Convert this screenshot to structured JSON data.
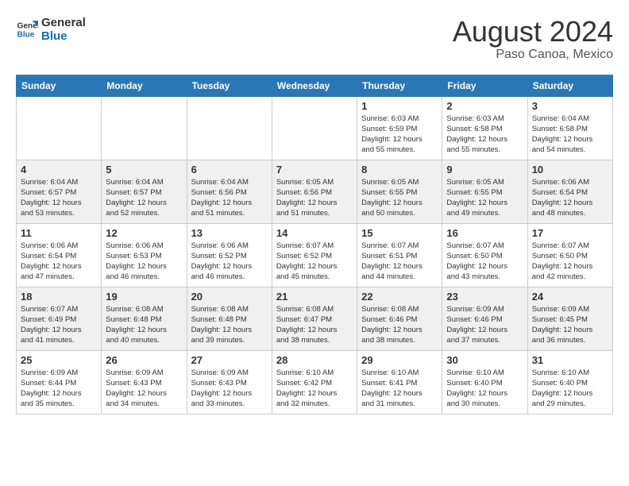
{
  "header": {
    "logo_line1": "General",
    "logo_line2": "Blue",
    "month_year": "August 2024",
    "location": "Paso Canoa, Mexico"
  },
  "weekdays": [
    "Sunday",
    "Monday",
    "Tuesday",
    "Wednesday",
    "Thursday",
    "Friday",
    "Saturday"
  ],
  "weeks": [
    [
      {
        "day": "",
        "info": ""
      },
      {
        "day": "",
        "info": ""
      },
      {
        "day": "",
        "info": ""
      },
      {
        "day": "",
        "info": ""
      },
      {
        "day": "1",
        "info": "Sunrise: 6:03 AM\nSunset: 6:59 PM\nDaylight: 12 hours\nand 55 minutes."
      },
      {
        "day": "2",
        "info": "Sunrise: 6:03 AM\nSunset: 6:58 PM\nDaylight: 12 hours\nand 55 minutes."
      },
      {
        "day": "3",
        "info": "Sunrise: 6:04 AM\nSunset: 6:58 PM\nDaylight: 12 hours\nand 54 minutes."
      }
    ],
    [
      {
        "day": "4",
        "info": "Sunrise: 6:04 AM\nSunset: 6:57 PM\nDaylight: 12 hours\nand 53 minutes."
      },
      {
        "day": "5",
        "info": "Sunrise: 6:04 AM\nSunset: 6:57 PM\nDaylight: 12 hours\nand 52 minutes."
      },
      {
        "day": "6",
        "info": "Sunrise: 6:04 AM\nSunset: 6:56 PM\nDaylight: 12 hours\nand 51 minutes."
      },
      {
        "day": "7",
        "info": "Sunrise: 6:05 AM\nSunset: 6:56 PM\nDaylight: 12 hours\nand 51 minutes."
      },
      {
        "day": "8",
        "info": "Sunrise: 6:05 AM\nSunset: 6:55 PM\nDaylight: 12 hours\nand 50 minutes."
      },
      {
        "day": "9",
        "info": "Sunrise: 6:05 AM\nSunset: 6:55 PM\nDaylight: 12 hours\nand 49 minutes."
      },
      {
        "day": "10",
        "info": "Sunrise: 6:06 AM\nSunset: 6:54 PM\nDaylight: 12 hours\nand 48 minutes."
      }
    ],
    [
      {
        "day": "11",
        "info": "Sunrise: 6:06 AM\nSunset: 6:54 PM\nDaylight: 12 hours\nand 47 minutes."
      },
      {
        "day": "12",
        "info": "Sunrise: 6:06 AM\nSunset: 6:53 PM\nDaylight: 12 hours\nand 46 minutes."
      },
      {
        "day": "13",
        "info": "Sunrise: 6:06 AM\nSunset: 6:52 PM\nDaylight: 12 hours\nand 46 minutes."
      },
      {
        "day": "14",
        "info": "Sunrise: 6:07 AM\nSunset: 6:52 PM\nDaylight: 12 hours\nand 45 minutes."
      },
      {
        "day": "15",
        "info": "Sunrise: 6:07 AM\nSunset: 6:51 PM\nDaylight: 12 hours\nand 44 minutes."
      },
      {
        "day": "16",
        "info": "Sunrise: 6:07 AM\nSunset: 6:50 PM\nDaylight: 12 hours\nand 43 minutes."
      },
      {
        "day": "17",
        "info": "Sunrise: 6:07 AM\nSunset: 6:50 PM\nDaylight: 12 hours\nand 42 minutes."
      }
    ],
    [
      {
        "day": "18",
        "info": "Sunrise: 6:07 AM\nSunset: 6:49 PM\nDaylight: 12 hours\nand 41 minutes."
      },
      {
        "day": "19",
        "info": "Sunrise: 6:08 AM\nSunset: 6:48 PM\nDaylight: 12 hours\nand 40 minutes."
      },
      {
        "day": "20",
        "info": "Sunrise: 6:08 AM\nSunset: 6:48 PM\nDaylight: 12 hours\nand 39 minutes."
      },
      {
        "day": "21",
        "info": "Sunrise: 6:08 AM\nSunset: 6:47 PM\nDaylight: 12 hours\nand 38 minutes."
      },
      {
        "day": "22",
        "info": "Sunrise: 6:08 AM\nSunset: 6:46 PM\nDaylight: 12 hours\nand 38 minutes."
      },
      {
        "day": "23",
        "info": "Sunrise: 6:09 AM\nSunset: 6:46 PM\nDaylight: 12 hours\nand 37 minutes."
      },
      {
        "day": "24",
        "info": "Sunrise: 6:09 AM\nSunset: 6:45 PM\nDaylight: 12 hours\nand 36 minutes."
      }
    ],
    [
      {
        "day": "25",
        "info": "Sunrise: 6:09 AM\nSunset: 6:44 PM\nDaylight: 12 hours\nand 35 minutes."
      },
      {
        "day": "26",
        "info": "Sunrise: 6:09 AM\nSunset: 6:43 PM\nDaylight: 12 hours\nand 34 minutes."
      },
      {
        "day": "27",
        "info": "Sunrise: 6:09 AM\nSunset: 6:43 PM\nDaylight: 12 hours\nand 33 minutes."
      },
      {
        "day": "28",
        "info": "Sunrise: 6:10 AM\nSunset: 6:42 PM\nDaylight: 12 hours\nand 32 minutes."
      },
      {
        "day": "29",
        "info": "Sunrise: 6:10 AM\nSunset: 6:41 PM\nDaylight: 12 hours\nand 31 minutes."
      },
      {
        "day": "30",
        "info": "Sunrise: 6:10 AM\nSunset: 6:40 PM\nDaylight: 12 hours\nand 30 minutes."
      },
      {
        "day": "31",
        "info": "Sunrise: 6:10 AM\nSunset: 6:40 PM\nDaylight: 12 hours\nand 29 minutes."
      }
    ]
  ]
}
